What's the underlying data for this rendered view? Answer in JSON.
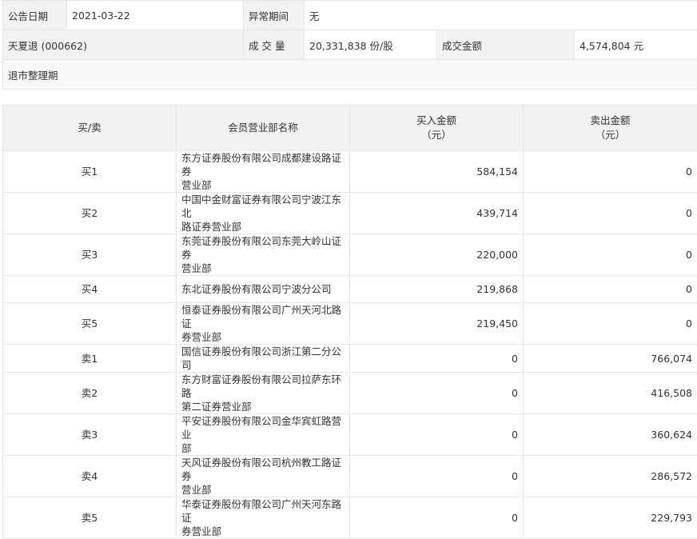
{
  "info": {
    "date_label": "公告日期",
    "date_value": "2021-03-22",
    "abnormal_label": "异常期间",
    "abnormal_value": "无",
    "stock_name": "天夏退 (000662)",
    "volume_label": "成 交 量",
    "volume_value": "20,331,838 份/股",
    "amount_label": "成交金额",
    "amount_value": "4,574,804 元",
    "note": "退市整理期"
  },
  "table": {
    "headers": {
      "side": "买/卖",
      "branch": "会员营业部名称",
      "buy_line1": "买入金额",
      "buy_line2": "（元）",
      "sell_line1": "卖出金额",
      "sell_line2": "（元）"
    },
    "rows": [
      {
        "side": "买1",
        "branch_l1": "东方证券股份有限公司成都建设路证券",
        "branch_l2": "营业部",
        "buy": "584,154",
        "sell": "0"
      },
      {
        "side": "买2",
        "branch_l1": "中国中金财富证券有限公司宁波江东北",
        "branch_l2": "路证券营业部",
        "buy": "439,714",
        "sell": "0"
      },
      {
        "side": "买3",
        "branch_l1": "东莞证券股份有限公司东莞大岭山证券",
        "branch_l2": "营业部",
        "buy": "220,000",
        "sell": "0"
      },
      {
        "side": "买4",
        "branch_l1": "东北证券股份有限公司宁波分公司",
        "branch_l2": "",
        "buy": "219,868",
        "sell": "0"
      },
      {
        "side": "买5",
        "branch_l1": "恒泰证券股份有限公司广州天河北路证",
        "branch_l2": "券营业部",
        "buy": "219,450",
        "sell": "0"
      },
      {
        "side": "卖1",
        "branch_l1": "国信证券股份有限公司浙江第二分公司",
        "branch_l2": "",
        "buy": "0",
        "sell": "766,074"
      },
      {
        "side": "卖2",
        "branch_l1": "东方财富证券股份有限公司拉萨东环路",
        "branch_l2": "第二证券营业部",
        "buy": "0",
        "sell": "416,508"
      },
      {
        "side": "卖3",
        "branch_l1": "平安证券股份有限公司金华宾虹路营业",
        "branch_l2": "部",
        "buy": "0",
        "sell": "360,624"
      },
      {
        "side": "卖4",
        "branch_l1": "天风证券股份有限公司杭州教工路证券",
        "branch_l2": "营业部",
        "buy": "0",
        "sell": "286,572"
      },
      {
        "side": "卖5",
        "branch_l1": "华泰证券股份有限公司广州天河东路证",
        "branch_l2": "券营业部",
        "buy": "0",
        "sell": "229,793"
      }
    ]
  }
}
